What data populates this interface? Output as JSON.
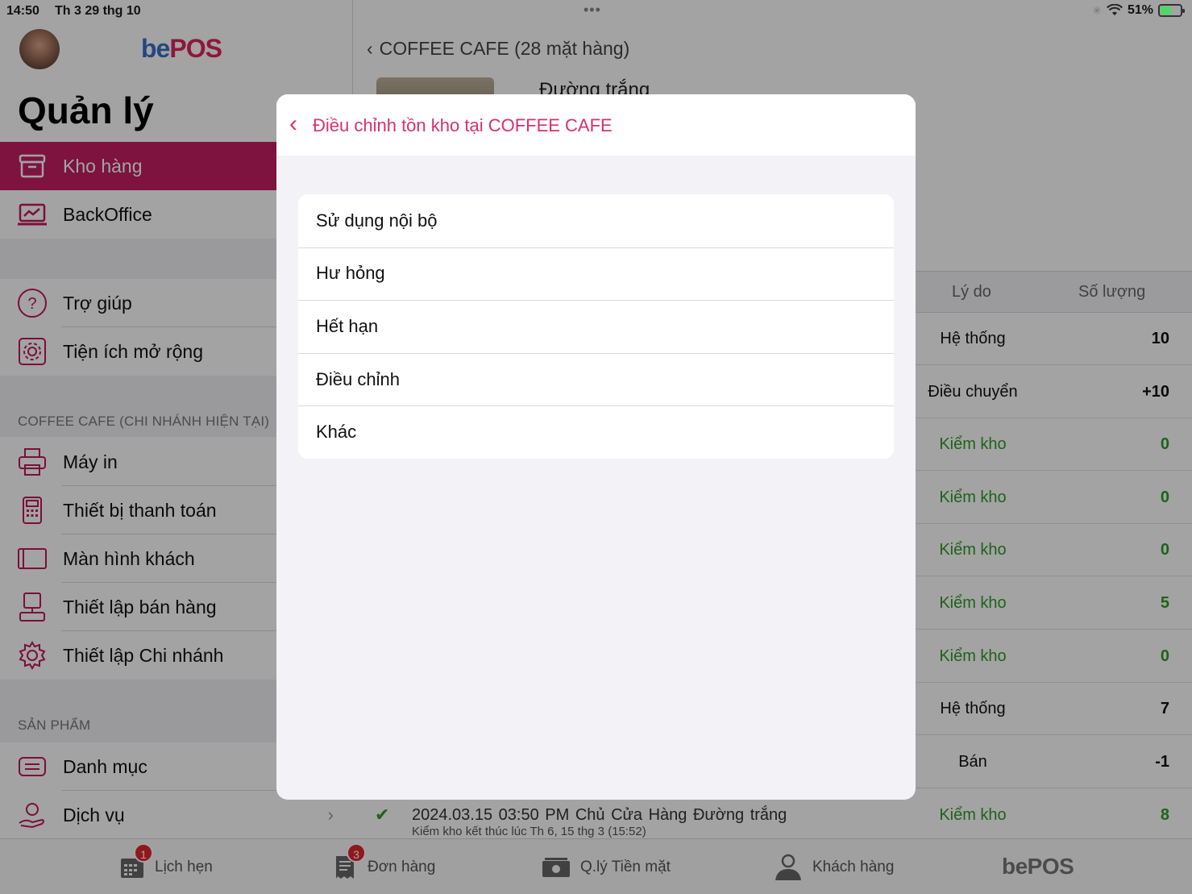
{
  "status_bar": {
    "time": "14:50",
    "date": "Th 3 29 thg 10",
    "battery": "51%",
    "battery_level": 0.51
  },
  "sidebar": {
    "logo_be": "be",
    "logo_pos": "POS",
    "title": "Quản lý",
    "top_items": [
      {
        "label": "Kho hàng",
        "icon": "archive-box-icon",
        "active": true
      },
      {
        "label": "BackOffice",
        "icon": "laptop-chart-icon",
        "active": false
      }
    ],
    "help_items": [
      {
        "label": "Trợ giúp",
        "icon": "question-circle-icon"
      },
      {
        "label": "Tiện ích mở rộng",
        "icon": "gear-icon"
      }
    ],
    "branch_section": "COFFEE CAFE (CHI NHÁNH HIỆN TẠI)",
    "branch_items": [
      {
        "label": "Máy in",
        "icon": "printer-icon"
      },
      {
        "label": "Thiết bị thanh toán",
        "icon": "payment-terminal-icon"
      },
      {
        "label": "Màn hình khách",
        "icon": "tablet-icon"
      },
      {
        "label": "Thiết lập bán hàng",
        "icon": "pos-terminal-icon"
      },
      {
        "label": "Thiết lập Chi nhánh",
        "icon": "gear-icon"
      }
    ],
    "product_section": "SẢN PHẨM",
    "product_items": [
      {
        "label": "Danh mục",
        "icon": "list-icon"
      },
      {
        "label": "Dịch vụ",
        "icon": "hand-service-icon"
      }
    ]
  },
  "main": {
    "breadcrumb": "COFFEE CAFE (28 mặt hàng)",
    "product_title": "Đường trắng",
    "table_headers": {
      "reason": "Lý do",
      "qty": "Số lượng"
    },
    "rows": [
      {
        "reason": "Hệ thống",
        "qty": "10",
        "green": false
      },
      {
        "reason": "Điều chuyển",
        "qty": "+10",
        "green": false
      },
      {
        "reason": "Kiểm kho",
        "qty": "0",
        "green": true
      },
      {
        "reason": "Kiểm kho",
        "qty": "0",
        "green": true
      },
      {
        "reason": "Kiểm kho",
        "qty": "0",
        "green": true
      },
      {
        "reason": "Kiểm kho",
        "qty": "5",
        "green": true
      },
      {
        "reason": "Kiểm kho",
        "qty": "0",
        "green": true
      },
      {
        "reason": "Hệ thống",
        "qty": "7",
        "green": false
      },
      {
        "reason": "Bán",
        "qty": "-1",
        "green": false
      }
    ],
    "last_row": {
      "line1": "2024.03.15 03:50 PM   Chủ Cửa Hàng   Đường trắng",
      "line2": "Kiểm kho kết thúc lúc Th 6, 15 thg 3 (15:52)",
      "reason": "Kiểm kho",
      "qty": "8"
    }
  },
  "modal": {
    "title": "Điều chỉnh tồn kho tại COFFEE CAFE",
    "options": [
      "Sử dụng nội bộ",
      "Hư hỏng",
      "Hết hạn",
      "Điều chỉnh",
      "Khác"
    ]
  },
  "tabbar": {
    "tabs": [
      {
        "label": "Lịch hẹn",
        "badge": "1",
        "icon": "calendar-icon"
      },
      {
        "label": "Đơn hàng",
        "badge": "3",
        "icon": "receipt-icon"
      },
      {
        "label": "Q.lý Tiền mặt",
        "badge": "",
        "icon": "cash-icon"
      },
      {
        "label": "Khách hàng",
        "badge": "",
        "icon": "person-icon"
      }
    ],
    "brand": "bePOS"
  },
  "colors": {
    "accent": "#c41e62",
    "modal_accent": "#d8306e",
    "positive": "#2e9b28"
  }
}
